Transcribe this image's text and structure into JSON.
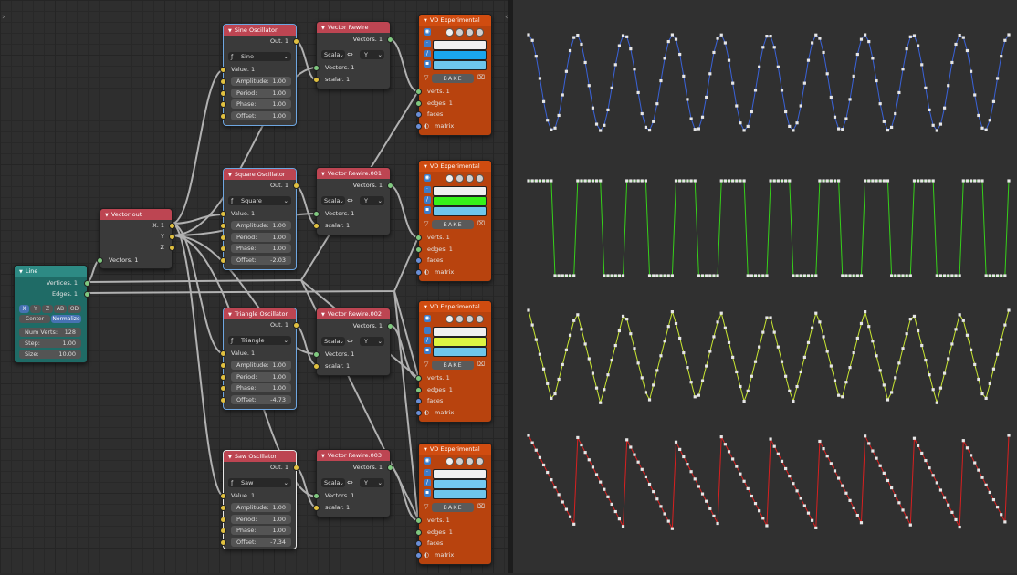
{
  "nodes": {
    "line": {
      "title": "Line",
      "outputs": [
        "Vertices. 1",
        "Edges. 1"
      ],
      "dir_buttons": [
        "X",
        "Y",
        "Z",
        "AB",
        "OD"
      ],
      "center": "Center",
      "normalize": "Normalize",
      "num_verts": {
        "label": "Num Verts:",
        "value": "128"
      },
      "step": {
        "label": "Step:",
        "value": "1.00"
      },
      "size": {
        "label": "Size:",
        "value": "10.00"
      }
    },
    "vector_out": {
      "title": "Vector out",
      "outputs": [
        "X. 1",
        "Y",
        "Z"
      ],
      "input": "Vectors. 1"
    },
    "oscillators": [
      {
        "title": "Sine Oscillator",
        "out": "Out. 1",
        "mode": "Sine",
        "value": "Value. 1",
        "params": [
          {
            "label": "Amplitude:",
            "value": "1.00"
          },
          {
            "label": "Period:",
            "value": "1.00"
          },
          {
            "label": "Phase:",
            "value": "1.00"
          },
          {
            "label": "Offset:",
            "value": "1.00"
          }
        ]
      },
      {
        "title": "Square Oscillator",
        "out": "Out. 1",
        "mode": "Square",
        "value": "Value. 1",
        "params": [
          {
            "label": "Amplitude:",
            "value": "1.00"
          },
          {
            "label": "Period:",
            "value": "1.00"
          },
          {
            "label": "Phase:",
            "value": "1.00"
          },
          {
            "label": "Offset:",
            "value": "-2.03"
          }
        ]
      },
      {
        "title": "Triangle Oscillator",
        "out": "Out. 1",
        "mode": "Triangle",
        "value": "Value. 1",
        "params": [
          {
            "label": "Amplitude:",
            "value": "1.00"
          },
          {
            "label": "Period:",
            "value": "1.00"
          },
          {
            "label": "Phase:",
            "value": "1.00"
          },
          {
            "label": "Offset:",
            "value": "-4.73"
          }
        ]
      },
      {
        "title": "Saw Oscillator",
        "out": "Out. 1",
        "mode": "Saw",
        "value": "Value. 1",
        "params": [
          {
            "label": "Amplitude:",
            "value": "1.00"
          },
          {
            "label": "Period:",
            "value": "1.00"
          },
          {
            "label": "Phase:",
            "value": "1.00"
          },
          {
            "label": "Offset:",
            "value": "-7.34"
          }
        ]
      }
    ],
    "rewires": [
      {
        "title": "Vector Rewire",
        "out": "Vectors. 1",
        "from": "Scala",
        "to": "Y",
        "in1": "Vectors. 1",
        "in2": "scalar. 1"
      },
      {
        "title": "Vector Rewire.001",
        "out": "Vectors. 1",
        "from": "Scala",
        "to": "Y",
        "in1": "Vectors. 1",
        "in2": "scalar. 1"
      },
      {
        "title": "Vector Rewire.002",
        "out": "Vectors. 1",
        "from": "Scala",
        "to": "Y",
        "in1": "Vectors. 1",
        "in2": "scalar. 1"
      },
      {
        "title": "Vector Rewire.003",
        "out": "Vectors. 1",
        "from": "Scala",
        "to": "Y",
        "in1": "Vectors. 1",
        "in2": "scalar. 1"
      }
    ],
    "viewers": [
      {
        "title": "VD Experimental",
        "bake": "BAKE",
        "inputs": [
          "verts. 1",
          "edges. 1",
          "faces",
          "matrix"
        ],
        "edge_color": "#1aa6ee"
      },
      {
        "title": "VD Experimental",
        "bake": "BAKE",
        "inputs": [
          "verts. 1",
          "edges. 1",
          "faces",
          "matrix"
        ],
        "edge_color": "#36f21a"
      },
      {
        "title": "VD Experimental",
        "bake": "BAKE",
        "inputs": [
          "verts. 1",
          "edges. 1",
          "faces",
          "matrix"
        ],
        "edge_color": "#ddf542"
      },
      {
        "title": "VD Experimental",
        "bake": "BAKE",
        "inputs": [
          "verts. 1",
          "edges. 1",
          "faces",
          "matrix"
        ],
        "edge_color": "#73c8f0"
      }
    ]
  },
  "waves": [
    {
      "kind": "sine",
      "color": "#3a62d8"
    },
    {
      "kind": "square",
      "color": "#36d01a"
    },
    {
      "kind": "triangle",
      "color": "#c8e632"
    },
    {
      "kind": "saw",
      "color": "#d82020"
    }
  ]
}
